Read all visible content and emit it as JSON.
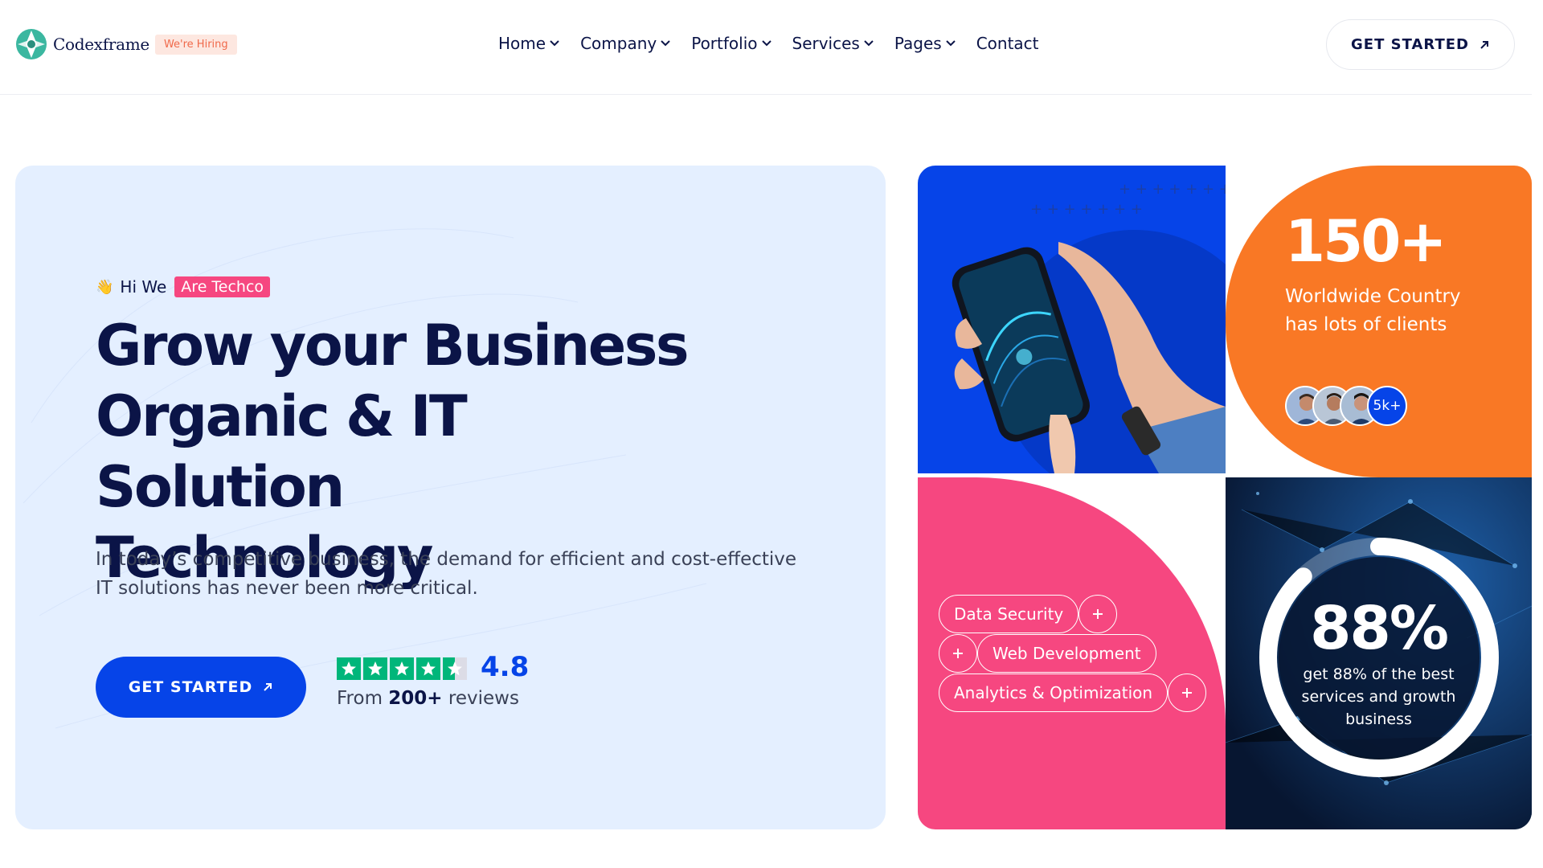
{
  "brand": {
    "name": "Codexframe",
    "hiring_badge": "We're Hiring"
  },
  "nav": {
    "items": [
      {
        "label": "Home",
        "has_dropdown": true
      },
      {
        "label": "Company",
        "has_dropdown": true
      },
      {
        "label": "Portfolio",
        "has_dropdown": true
      },
      {
        "label": "Services",
        "has_dropdown": true
      },
      {
        "label": "Pages",
        "has_dropdown": true
      },
      {
        "label": "Contact",
        "has_dropdown": false
      }
    ],
    "cta_label": "GET STARTED"
  },
  "hero": {
    "greeting": "Hi We",
    "greeting_tag": "Are Techco",
    "headline": [
      "Grow your Business",
      "Organic & IT Solution",
      "Technology"
    ],
    "description": "In today’s competitive business, the demand for efficient and cost-effective IT solutions has never been more critical.",
    "cta_label": "GET STARTED",
    "rating_stars": 4.5,
    "rating_value": "4.8",
    "reviews_prefix": "From",
    "reviews_count": "200+",
    "reviews_suffix": "reviews"
  },
  "stats": {
    "clients_number": "150+",
    "clients_text": "Worldwide Country has lots of clients",
    "avatars_more": "5k+",
    "percent_value": "88%",
    "percent_fraction": 0.88,
    "percent_text": "get 88% of the best services and growth business"
  },
  "services": {
    "pills": [
      "Data Security",
      "Web Development",
      "Analytics & Optimization"
    ]
  },
  "colors": {
    "primary": "#0644e8",
    "orange": "#f97825",
    "pink": "#f64780",
    "navy": "#0b1447",
    "hero_bg": "#e4efff",
    "trustpilot": "#00b67a"
  }
}
